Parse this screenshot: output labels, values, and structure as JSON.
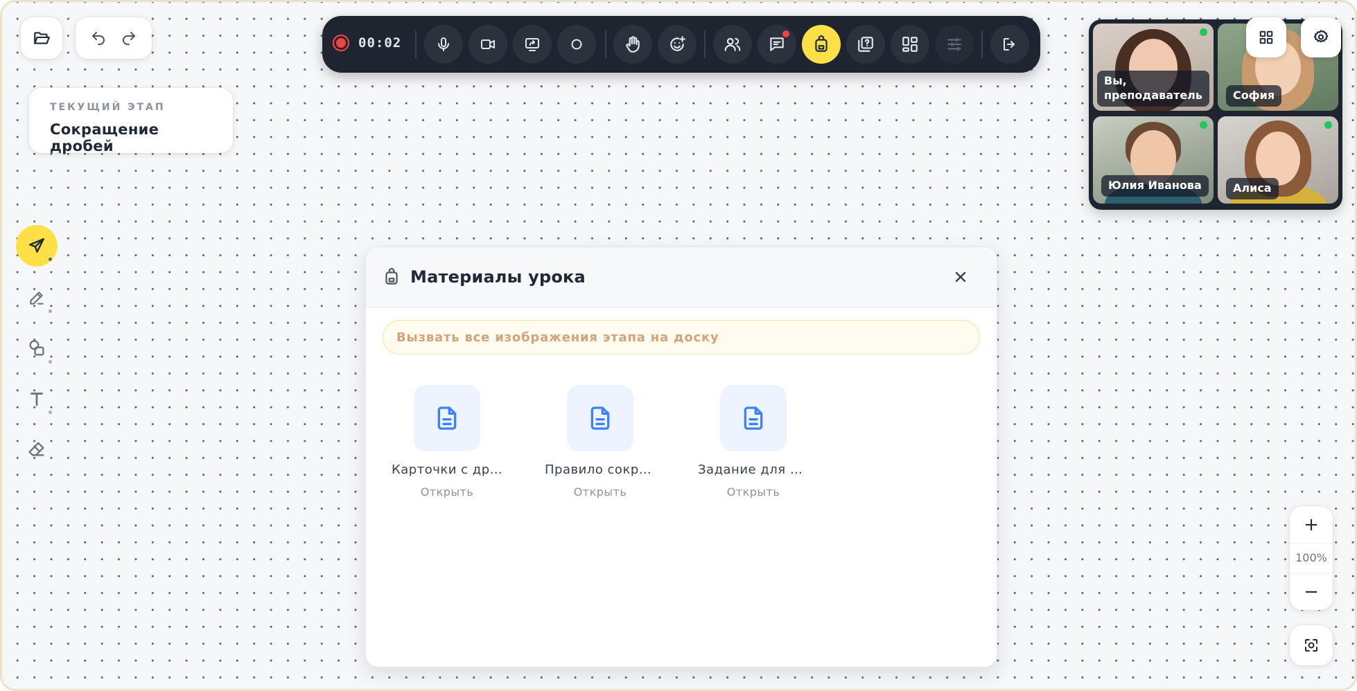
{
  "top_left": {
    "folder_icon": "folder-open-icon",
    "undo_icon": "undo-icon",
    "redo_icon": "redo-icon"
  },
  "stage_card": {
    "label": "ТЕКУЩИЙ ЭТАП",
    "title": "Сокращение дробей"
  },
  "tools": [
    {
      "name": "pointer",
      "icon": "send-arrow-icon",
      "active": true
    },
    {
      "name": "pen",
      "icon": "pen-icon",
      "active": false
    },
    {
      "name": "shapes",
      "icon": "shapes-icon",
      "active": false
    },
    {
      "name": "text",
      "icon": "text-icon",
      "active": false
    },
    {
      "name": "eraser",
      "icon": "eraser-icon",
      "active": false
    }
  ],
  "toolbar": {
    "timer": "00:02",
    "recording_color": "#ef4444",
    "buttons": [
      {
        "name": "microphone",
        "icon": "microphone-icon"
      },
      {
        "name": "camera",
        "icon": "video-camera-icon"
      },
      {
        "name": "screen-share",
        "icon": "screen-share-icon"
      },
      {
        "name": "record",
        "icon": "circle-icon"
      },
      {
        "name": "raise-hand",
        "icon": "hand-icon"
      },
      {
        "name": "reactions",
        "icon": "emoji-add-icon"
      },
      {
        "name": "participants",
        "icon": "users-icon"
      },
      {
        "name": "chat",
        "icon": "chat-icon",
        "has_notification": true
      },
      {
        "name": "materials",
        "icon": "backpack-icon",
        "active": true
      },
      {
        "name": "quiz",
        "icon": "question-cards-icon"
      },
      {
        "name": "layout",
        "icon": "dashboard-icon"
      },
      {
        "name": "adjustments",
        "icon": "sliders-icon",
        "disabled": true
      },
      {
        "name": "leave",
        "icon": "logout-icon"
      }
    ]
  },
  "participants": [
    {
      "name": "Вы, преподаватель",
      "online": true
    },
    {
      "name": "София",
      "online": false
    },
    {
      "name": "Юлия Иванова",
      "online": true
    },
    {
      "name": "Алиса",
      "online": true
    }
  ],
  "video_controls": {
    "grid_icon": "grid-icon",
    "settings_icon": "gear-icon"
  },
  "modal": {
    "title": "Материалы урока",
    "banner": "Вызвать все изображения этапа на доску",
    "files": [
      {
        "name": "Карточки с дробями",
        "action": "Открыть"
      },
      {
        "name": "Правило сокращения",
        "action": "Открыть"
      },
      {
        "name": "Задание для группы",
        "action": "Открыть"
      }
    ]
  },
  "zoom": {
    "plus": "+",
    "level": "100%",
    "minus": "−",
    "fit_icon": "fit-screen-icon"
  },
  "colors": {
    "accent_yellow": "#fde047",
    "toolbar_dark": "#1f2530",
    "file_blue": "#3b82f6",
    "online_green": "#22c55e"
  }
}
